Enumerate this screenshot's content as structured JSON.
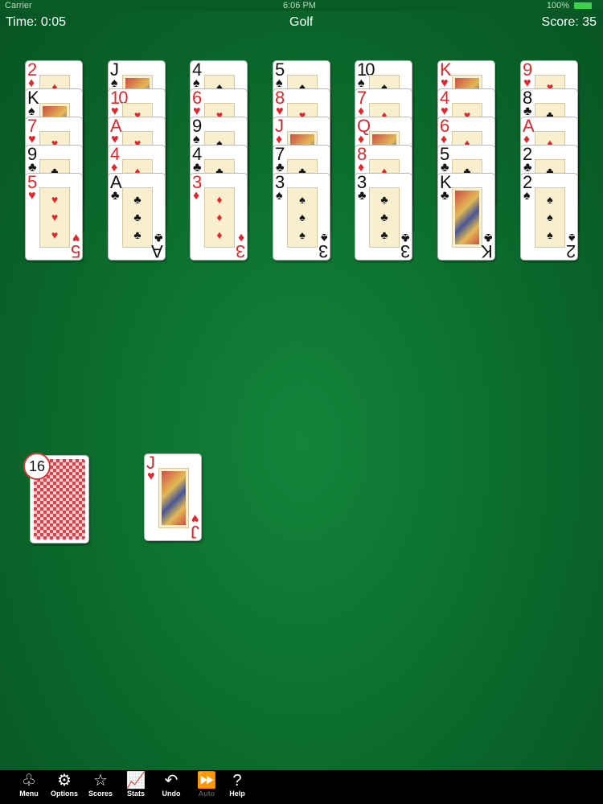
{
  "status": {
    "carrier": "Carrier",
    "time": "6:06 PM",
    "battery": "100%"
  },
  "hud": {
    "time": "Time: 0:05",
    "title": "Golf",
    "score": "Score: 35"
  },
  "tableau": [
    [
      {
        "rank": "2",
        "suit": "♦",
        "color": "red"
      },
      {
        "rank": "K",
        "suit": "♠",
        "color": "black"
      },
      {
        "rank": "7",
        "suit": "♥",
        "color": "red"
      },
      {
        "rank": "9",
        "suit": "♣",
        "color": "black"
      },
      {
        "rank": "5",
        "suit": "♥",
        "color": "red"
      }
    ],
    [
      {
        "rank": "J",
        "suit": "♠",
        "color": "black"
      },
      {
        "rank": "10",
        "suit": "♥",
        "color": "red"
      },
      {
        "rank": "A",
        "suit": "♥",
        "color": "red"
      },
      {
        "rank": "4",
        "suit": "♦",
        "color": "red"
      },
      {
        "rank": "A",
        "suit": "♣",
        "color": "black"
      }
    ],
    [
      {
        "rank": "4",
        "suit": "♠",
        "color": "black"
      },
      {
        "rank": "6",
        "suit": "♥",
        "color": "red"
      },
      {
        "rank": "9",
        "suit": "♠",
        "color": "black"
      },
      {
        "rank": "4",
        "suit": "♣",
        "color": "black"
      },
      {
        "rank": "3",
        "suit": "♦",
        "color": "red"
      }
    ],
    [
      {
        "rank": "5",
        "suit": "♠",
        "color": "black"
      },
      {
        "rank": "8",
        "suit": "♥",
        "color": "red"
      },
      {
        "rank": "J",
        "suit": "♦",
        "color": "red"
      },
      {
        "rank": "7",
        "suit": "♣",
        "color": "black"
      },
      {
        "rank": "3",
        "suit": "♠",
        "color": "black"
      }
    ],
    [
      {
        "rank": "10",
        "suit": "♠",
        "color": "black"
      },
      {
        "rank": "7",
        "suit": "♦",
        "color": "red"
      },
      {
        "rank": "Q",
        "suit": "♦",
        "color": "red"
      },
      {
        "rank": "8",
        "suit": "♦",
        "color": "red"
      },
      {
        "rank": "3",
        "suit": "♣",
        "color": "black"
      }
    ],
    [
      {
        "rank": "K",
        "suit": "♥",
        "color": "red"
      },
      {
        "rank": "4",
        "suit": "♥",
        "color": "red"
      },
      {
        "rank": "6",
        "suit": "♦",
        "color": "red"
      },
      {
        "rank": "5",
        "suit": "♣",
        "color": "black"
      },
      {
        "rank": "K",
        "suit": "♣",
        "color": "black"
      }
    ],
    [
      {
        "rank": "9",
        "suit": "♥",
        "color": "red"
      },
      {
        "rank": "8",
        "suit": "♣",
        "color": "black"
      },
      {
        "rank": "A",
        "suit": "♦",
        "color": "red"
      },
      {
        "rank": "2",
        "suit": "♣",
        "color": "black"
      },
      {
        "rank": "2",
        "suit": "♠",
        "color": "black"
      }
    ]
  ],
  "stock": {
    "count": "16"
  },
  "waste": {
    "rank": "J",
    "suit": "♥",
    "color": "red"
  },
  "toolbar": [
    {
      "label": "Menu",
      "icon": "♧",
      "name": "menu",
      "enabled": true
    },
    {
      "label": "Options",
      "icon": "⚙",
      "name": "options",
      "enabled": true
    },
    {
      "label": "Scores",
      "icon": "☆",
      "name": "scores",
      "enabled": true
    },
    {
      "label": "Stats",
      "icon": "📈",
      "name": "stats",
      "enabled": true
    },
    {
      "label": "Undo",
      "icon": "↶",
      "name": "undo",
      "enabled": true
    },
    {
      "label": "Auto",
      "icon": "⏩",
      "name": "auto",
      "enabled": false
    },
    {
      "label": "Help",
      "icon": "?",
      "name": "help",
      "enabled": true
    }
  ]
}
